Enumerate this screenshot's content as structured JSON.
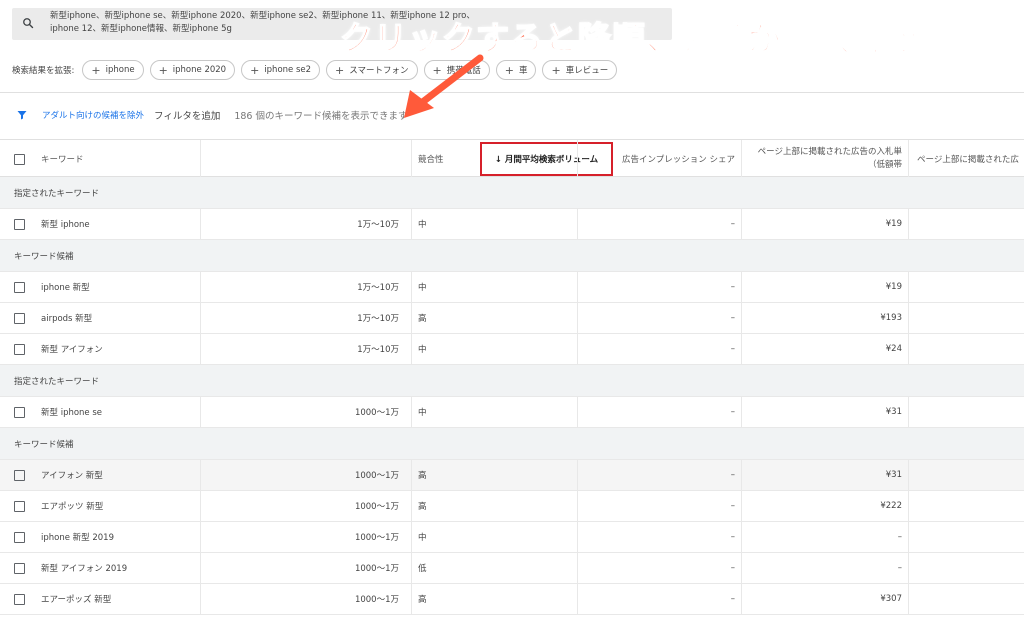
{
  "search": {
    "line1": "新型iphone、新型iphone se、新型iphone 2020、新型iphone se2、新型iphone 11、新型iphone 12 pro、",
    "line2": "iphone 12、新型iphone情報、新型iphone 5g"
  },
  "overlay": {
    "text": "クリックすると降順、昇順が選択可能",
    "color": "#ff5a3a"
  },
  "expand": {
    "label": "検索結果を拡張:",
    "chips": [
      "iphone",
      "iphone 2020",
      "iphone se2",
      "スマートフォン",
      "携帯電話",
      "車",
      "車レビュー"
    ]
  },
  "filter": {
    "adult": "アダルト向けの候補を除外",
    "add": "フィルタを追加",
    "count": "186 個のキーワード候補を表示できます"
  },
  "table": {
    "headers": {
      "keyword": "キーワード",
      "volume": "↓ 月間平均検索ボリューム",
      "competition": "競合性",
      "share": "広告インプレッション シェア",
      "bid_low_1": "ページ上部に掲載された広告の入札単",
      "bid_low_2": "（低額帯",
      "bid_high": "ページ上部に掲載された広"
    },
    "groups": [
      {
        "label": "指定されたキーワード",
        "rows": [
          {
            "keyword": "新型 iphone",
            "volume": "1万～10万",
            "competition": "中",
            "share": "–",
            "bid": "¥19"
          }
        ]
      },
      {
        "label": "キーワード候補",
        "rows": [
          {
            "keyword": "iphone 新型",
            "volume": "1万～10万",
            "competition": "中",
            "share": "–",
            "bid": "¥19"
          },
          {
            "keyword": "airpods 新型",
            "volume": "1万～10万",
            "competition": "高",
            "share": "–",
            "bid": "¥193"
          },
          {
            "keyword": "新型 アイフォン",
            "volume": "1万～10万",
            "competition": "中",
            "share": "–",
            "bid": "¥24"
          }
        ]
      },
      {
        "label": "指定されたキーワード",
        "rows": [
          {
            "keyword": "新型 iphone se",
            "volume": "1000～1万",
            "competition": "中",
            "share": "–",
            "bid": "¥31"
          }
        ]
      },
      {
        "label": "キーワード候補",
        "rows": [
          {
            "keyword": "アイフォン 新型",
            "volume": "1000～1万",
            "competition": "高",
            "share": "–",
            "bid": "¥31"
          },
          {
            "keyword": "エアポッツ 新型",
            "volume": "1000～1万",
            "competition": "高",
            "share": "–",
            "bid": "¥222"
          },
          {
            "keyword": "iphone 新型 2019",
            "volume": "1000～1万",
            "competition": "中",
            "share": "–",
            "bid": "–"
          },
          {
            "keyword": "新型 アイフォン 2019",
            "volume": "1000～1万",
            "competition": "低",
            "share": "–",
            "bid": "–"
          },
          {
            "keyword": "エアーポッズ 新型",
            "volume": "1000～1万",
            "competition": "高",
            "share": "–",
            "bid": "¥307"
          }
        ]
      }
    ]
  },
  "colors": {
    "accent": "#1a73e8",
    "highlight_box": "#d6202a"
  }
}
